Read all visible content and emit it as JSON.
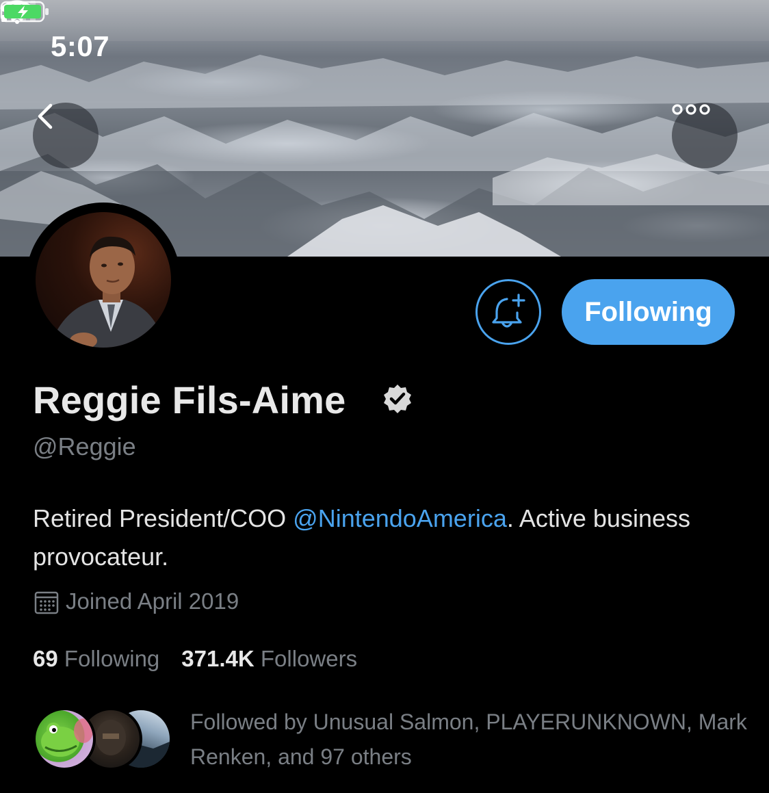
{
  "status_bar": {
    "time": "5:07"
  },
  "header": {
    "back_icon": "chevron-left-icon",
    "more_icon": "more-horizontal-icon"
  },
  "profile": {
    "display_name": "Reggie Fils-Aime",
    "verified": true,
    "handle": "@Reggie",
    "bio_prefix": "Retired President/COO ",
    "bio_mention": "@NintendoAmerica",
    "bio_suffix": ". Active business provocateur.",
    "joined": "Joined April 2019"
  },
  "actions": {
    "notify_icon": "bell-plus-icon",
    "following_label": "Following"
  },
  "stats": {
    "following_count": "69",
    "following_label": "Following",
    "followers_count": "371.4K",
    "followers_label": "Followers"
  },
  "followed_by": {
    "text": "Followed by Unusual Salmon, PLAYERUNKNOWN, Mark Renken, and 97 others"
  },
  "colors": {
    "accent": "#4aa3ee",
    "background": "#000000",
    "secondary_text": "#7a7f85"
  }
}
